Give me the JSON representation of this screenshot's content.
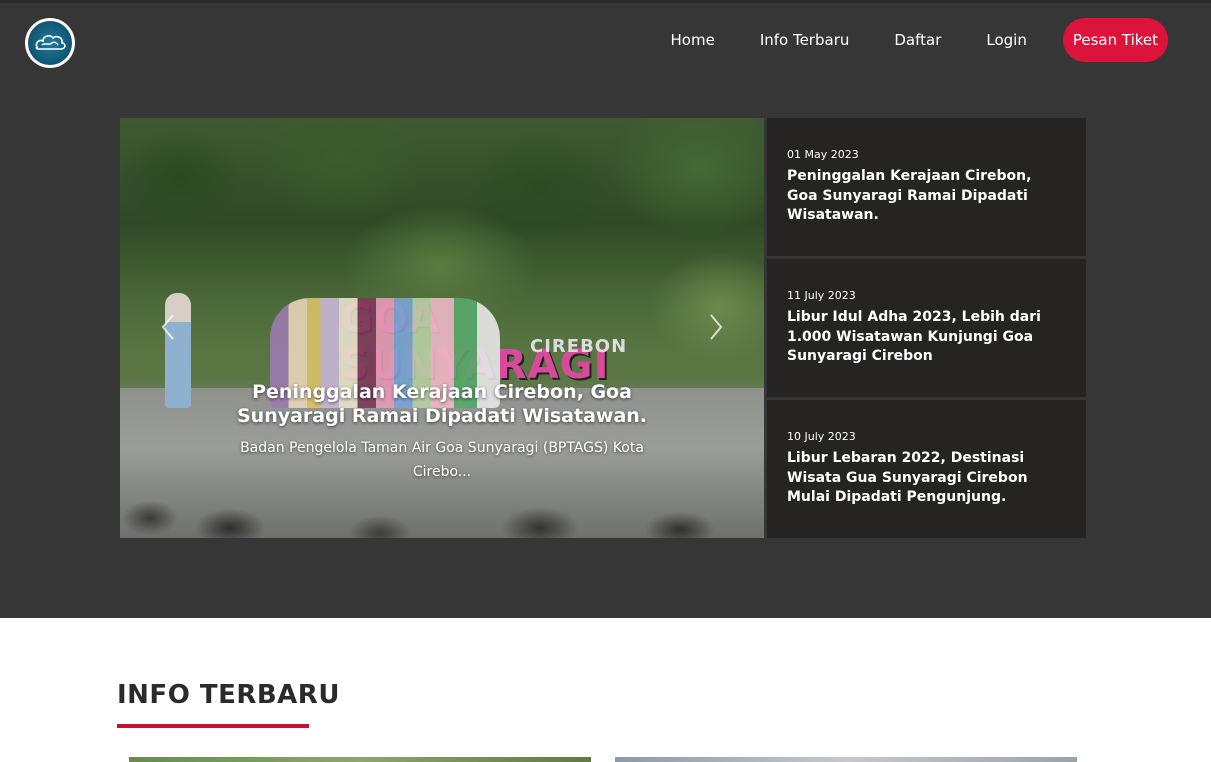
{
  "nav": {
    "items": [
      {
        "label": "Home"
      },
      {
        "label": "Info Terbaru"
      },
      {
        "label": "Daftar"
      },
      {
        "label": "Login"
      }
    ],
    "cta_label": "Pesan Tiket",
    "cta_color": "#dc143c"
  },
  "logo": {
    "icon": "cloud-logo-icon"
  },
  "carousel": {
    "sign_text": "GOA SUNYARAGI",
    "sign_sub": "CIREBON",
    "caption_title": "Peninggalan Kerajaan Cirebon, Goa Sunyaragi Ramai Dipadati Wisatawan.",
    "caption_text": "Badan Pengelola Taman Air Goa Sunyaragi (BPTAGS) Kota Cirebo...",
    "prev_icon": "chevron-left-icon",
    "next_icon": "chevron-right-icon"
  },
  "side_news": [
    {
      "date": "01 May 2023",
      "title": "Peninggalan Kerajaan Cirebon, Goa Sunyaragi Ramai Dipadati Wisatawan."
    },
    {
      "date": "11 July 2023",
      "title": "Libur Idul Adha 2023, Lebih dari 1.000 Wisatawan Kunjungi Goa Sunyaragi Cirebon"
    },
    {
      "date": "10 July 2023",
      "title": "Libur Lebaran 2022, Destinasi Wisata Gua Sunyaragi Cirebon Mulai Dipadati Pengunjung."
    }
  ],
  "section": {
    "title": "INFO TERBARU",
    "accent_color": "#c8102e"
  }
}
